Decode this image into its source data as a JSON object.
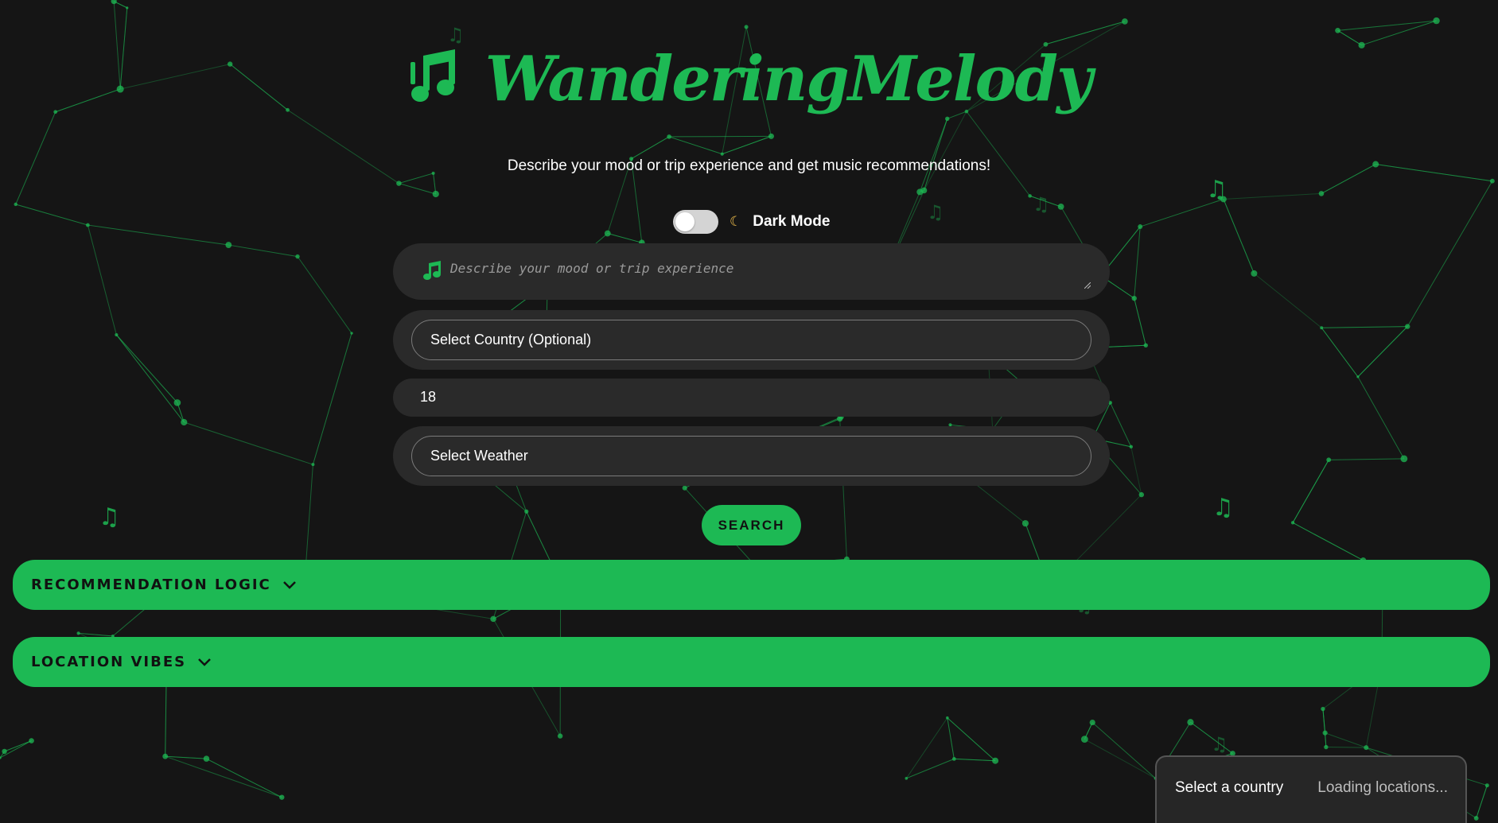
{
  "app": {
    "title": "WanderingMelody",
    "subtitle": "Describe your mood or trip experience and get music recommendations!"
  },
  "theme": {
    "accent": "#1db954",
    "background": "#151515",
    "panel": "#2a2a2a"
  },
  "toggle": {
    "label": "Dark Mode",
    "icon": "moon-icon",
    "checked": false
  },
  "mood": {
    "icon": "music-note-icon",
    "placeholder": "Describe your mood or trip experience",
    "value": ""
  },
  "country_select": {
    "selected": "Select Country (Optional)"
  },
  "age": {
    "value": "18"
  },
  "weather_select": {
    "selected": "Select Weather"
  },
  "search": {
    "label": "SEARCH"
  },
  "accordions": [
    {
      "label": "RECOMMENDATION LOGIC",
      "icon": "chevron-down-icon"
    },
    {
      "label": "LOCATION VIBES",
      "icon": "chevron-down-icon"
    }
  ],
  "country_popup": {
    "title": "Select a country",
    "status": "Loading locations..."
  },
  "background": {
    "pattern": "network-lines",
    "decorations": "music-note-icon"
  }
}
